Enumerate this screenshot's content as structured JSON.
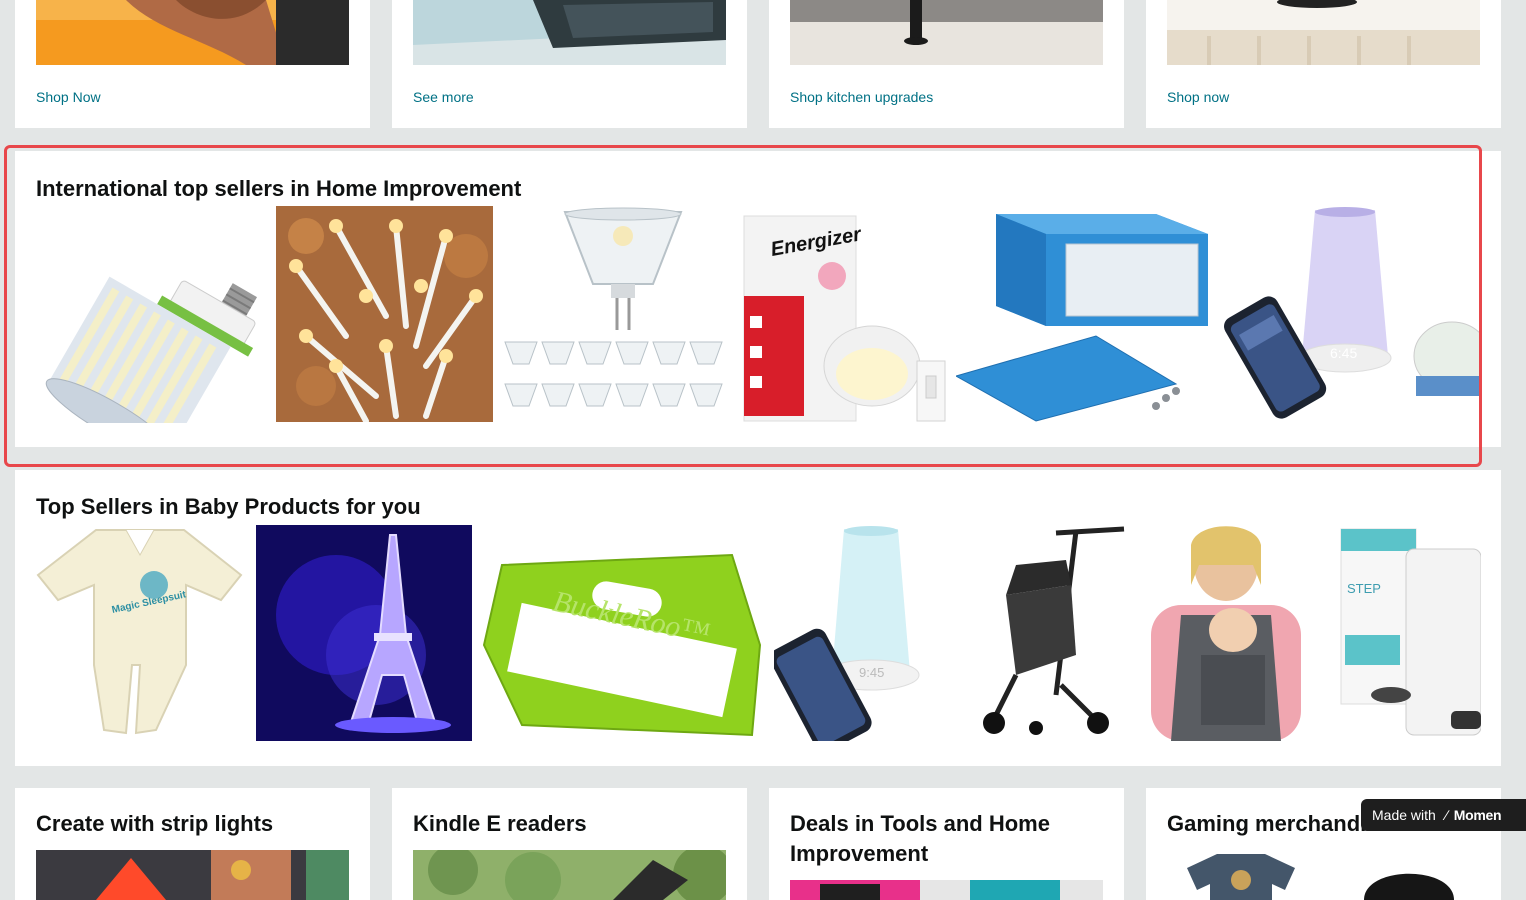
{
  "top_row": {
    "links": [
      "Shop Now",
      "See more",
      "Shop kitchen upgrades",
      "Shop now"
    ]
  },
  "intl_section": {
    "title": "International top sellers in Home Improvement",
    "products": [
      "corn-led-bulb",
      "string-lights",
      "mr16-bulb-pack",
      "energizer-puck-light",
      "blue-project-enclosure",
      "sunrise-alarm-light"
    ]
  },
  "baby_section": {
    "title": "Top Sellers in Baby Products for you",
    "products": [
      "sleep-suit",
      "eiffel-tower-night-light",
      "buckleroo-buckle-guard",
      "hatch-rest-light",
      "compact-stroller",
      "baby-carrier",
      "diaper-pail"
    ],
    "buckleroo_text": "BuckleRoo™",
    "sleepsuit_text": "Magic Sleepsuit",
    "pail_text": "STEP"
  },
  "bottom_row": {
    "cards": [
      {
        "title": "Create with strip lights"
      },
      {
        "title": "Kindle E readers"
      },
      {
        "title": "Deals in Tools and Home Improvement"
      },
      {
        "title": "Gaming merchandise"
      }
    ]
  },
  "badge": {
    "prefix": "Made with",
    "brand": "Momen"
  },
  "colors": {
    "link": "#007185",
    "page_bg": "#e3e6e6",
    "highlight": "#e8474b",
    "energizer_red": "#d81e2a",
    "enclosure_blue": "#2f8fd6",
    "buckleroo_green": "#8fd11e"
  }
}
